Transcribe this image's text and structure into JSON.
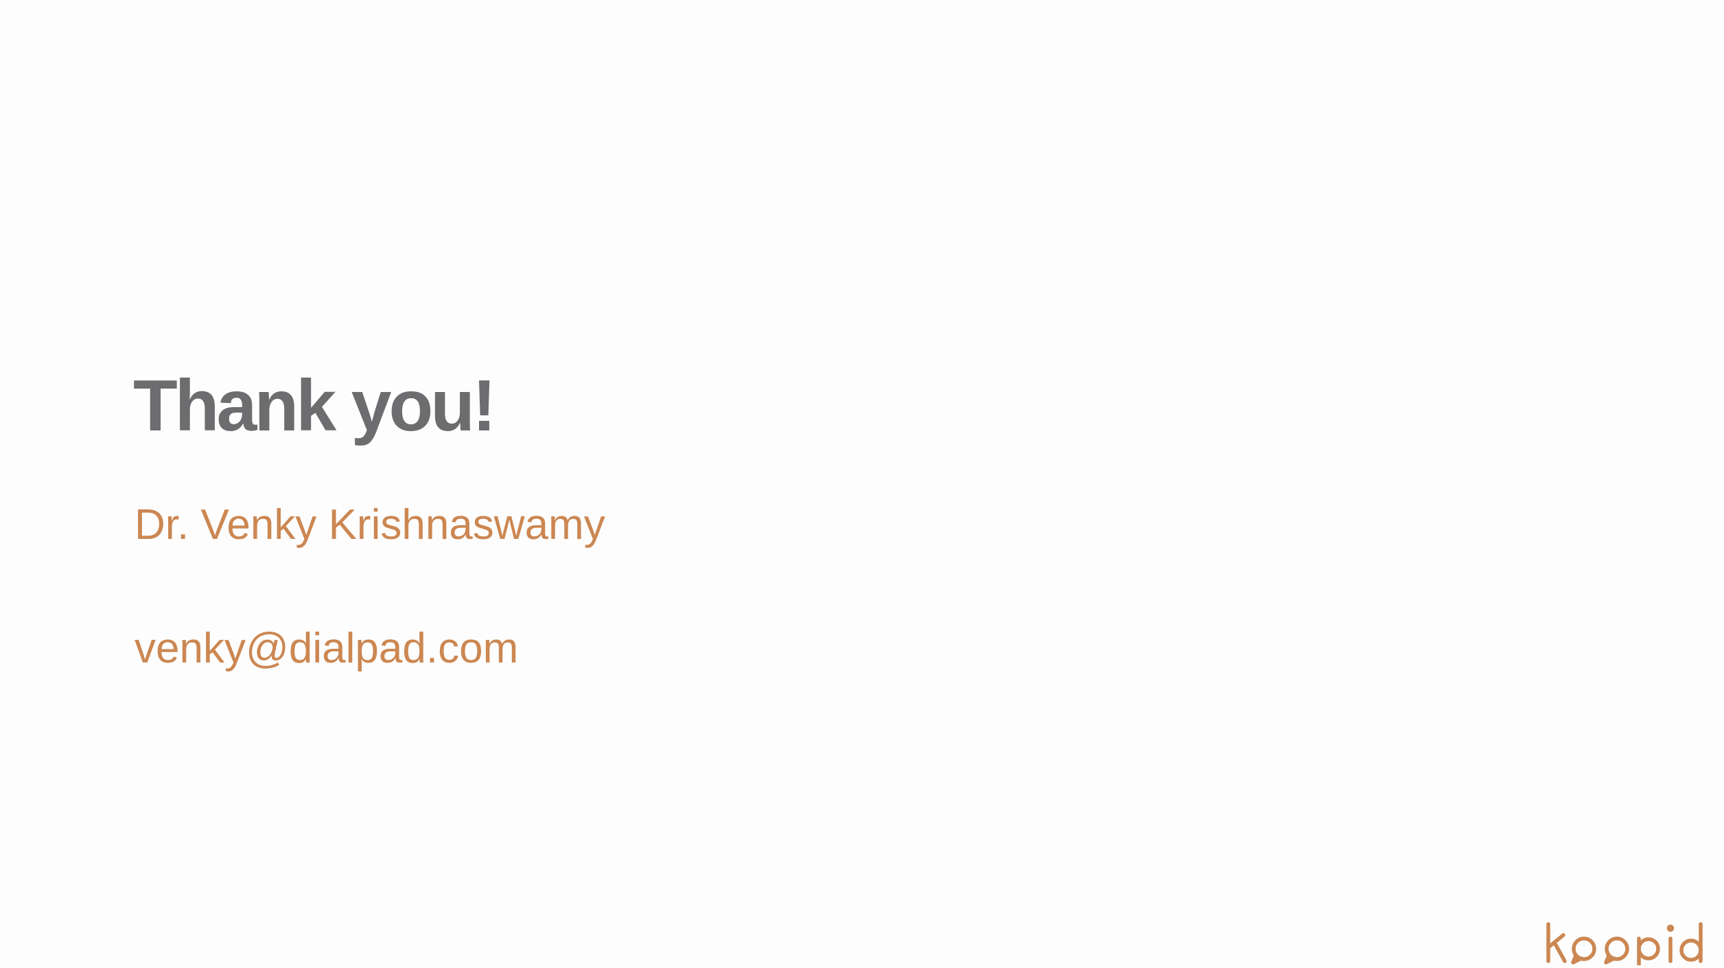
{
  "slide": {
    "title": "Thank you!",
    "presenter_name": "Dr. Venky Krishnaswamy",
    "email": "venky@dialpad.com",
    "logo_text": "koopid"
  },
  "colors": {
    "background": "#fdfdfd",
    "title": "#6d6d70",
    "accent": "#cc8752"
  }
}
